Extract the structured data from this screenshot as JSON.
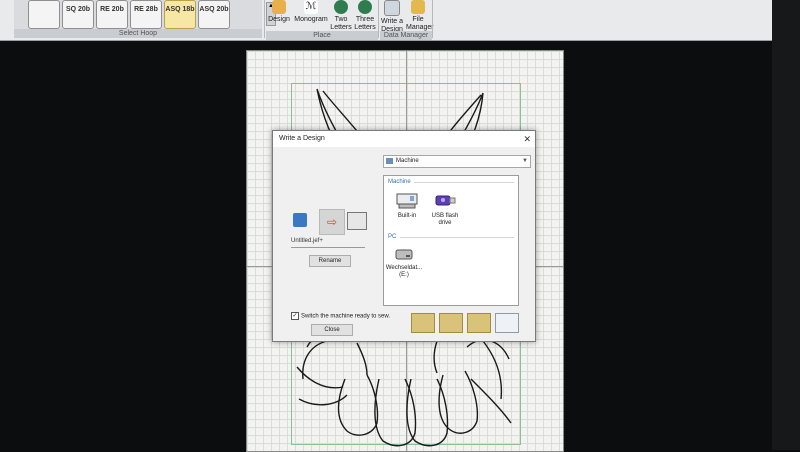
{
  "ribbon": {
    "hoop_group_label": "Select Hoop",
    "hoop_buttons": [
      {
        "label": ""
      },
      {
        "label": "SQ 20b"
      },
      {
        "label": "RE 20b"
      },
      {
        "label": "RE 28b"
      },
      {
        "label": "ASQ 18b"
      },
      {
        "label": "ASQ 20b"
      }
    ],
    "place_label": "Place",
    "data_manager_label": "Data Manager",
    "design_label": "Design",
    "monogram_label": "Monogram",
    "two_letters_label": "Two Letters",
    "three_letters_label": "Three Letters",
    "write_design_label": "Write a Design",
    "file_manager_label": "File Manager"
  },
  "dialog": {
    "title": "Write a Design",
    "close_glyph": "✕",
    "dropdown_value": "Machine",
    "machine_section": "Machine",
    "builtin_label": "Built-in",
    "usb_label": "USB flash drive",
    "pc_section": "PC",
    "removable_label": "Wechseldat... (E:)",
    "filename": "Untitled.jef+",
    "rename_label": "Rename",
    "switch_label": "Switch the machine ready to sew.",
    "close_label": "Close"
  }
}
